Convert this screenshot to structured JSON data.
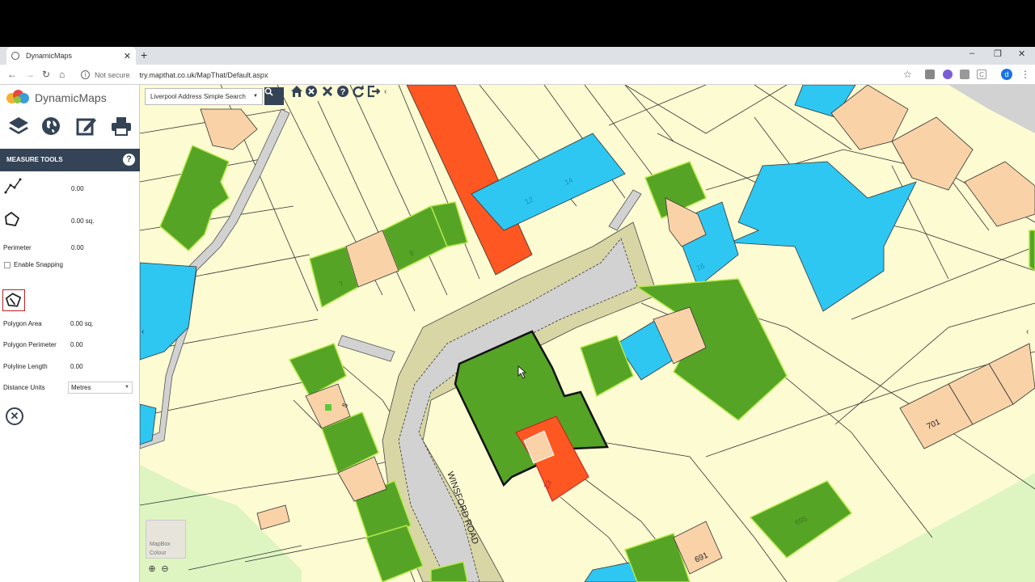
{
  "browser": {
    "tab_title": "DynamicMaps",
    "tab_close": "✕",
    "new_tab": "+",
    "security": "Not secure",
    "url": "try.mapthat.co.uk/MapThat/Default.aspx",
    "window_minimize": "–",
    "window_maximize": "❐",
    "window_close": "✕",
    "profile_initial": "d"
  },
  "app": {
    "logo_name": "DynamicMaps",
    "brand_colors": [
      "#e84a3a",
      "#f5b02e",
      "#3a9fd6",
      "#8cc63f"
    ]
  },
  "toolbar": {
    "icons": [
      "layers-icon",
      "globe-icon",
      "edit-icon",
      "print-icon"
    ]
  },
  "measure": {
    "header": "MEASURE TOOLS",
    "help": "?",
    "line_value": "0.00",
    "area_value": "0.00 sq.",
    "perimeter_label": "Perimeter",
    "perimeter_value": "0.00",
    "snapping_label": "Enable Snapping",
    "polygon_area_label": "Polygon Area",
    "polygon_area_value": "0.00 sq.",
    "polygon_perimeter_label": "Polygon Perimeter",
    "polygon_perimeter_value": "0.00",
    "polyline_length_label": "Polyline Length",
    "polyline_length_value": "0.00",
    "distance_units_label": "Distance Units",
    "distance_units_value": "Metres"
  },
  "map": {
    "search_placeholder": "Liverpool Address Simple Search",
    "road_name": "WINSFORD ROAD",
    "basemap_label": "MapBox Colour",
    "house_numbers": [
      "701",
      "691",
      "5",
      "7",
      "9",
      "12",
      "14",
      "16",
      "23",
      "695"
    ],
    "colors": {
      "background": "#fdfbd2",
      "road": "#d2d2d2",
      "verge": "#d9d6a6",
      "green": "#55a426",
      "blue": "#2ec7f2",
      "orange": "#ff5722",
      "peach": "#f9d2a8",
      "panel_header": "#344356"
    }
  }
}
